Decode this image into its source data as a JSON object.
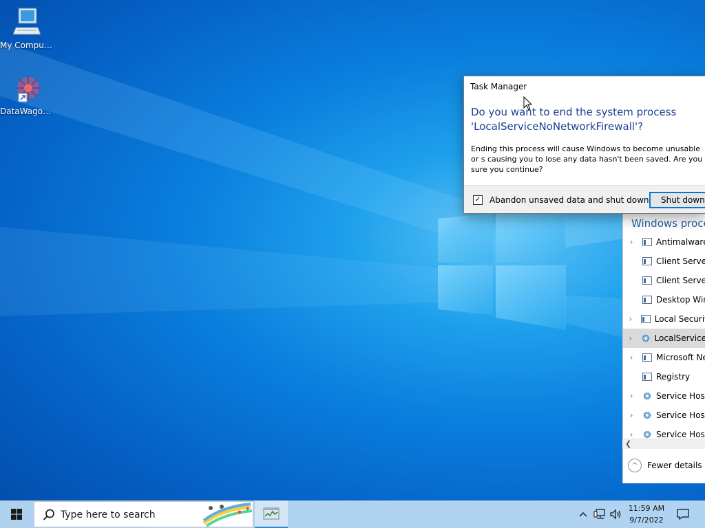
{
  "desktop": {
    "icons": [
      {
        "label": "My Computer",
        "icon": "computer-icon"
      },
      {
        "label": "DataWagon...",
        "icon": "datawagon-shortcut-icon"
      }
    ]
  },
  "dialog": {
    "title": "Task Manager",
    "heading": "Do you want to end the system process 'LocalServiceNoNetworkFirewall'?",
    "body": "Ending this process will cause Windows to become unusable or s causing you to lose any data hasn't been saved. Are you sure you continue?",
    "checkbox_label": "Abandon unsaved data and shut down.",
    "checkbox_checked": true,
    "button_label": "Shut down"
  },
  "task_manager": {
    "section_title": "Windows proce",
    "processes": [
      {
        "name": "Antimalware",
        "expandable": true,
        "icon": "window-icon",
        "selected": false
      },
      {
        "name": "Client Server",
        "expandable": false,
        "icon": "window-icon",
        "selected": false
      },
      {
        "name": "Client Server",
        "expandable": false,
        "icon": "window-icon",
        "selected": false
      },
      {
        "name": "Desktop Win",
        "expandable": false,
        "icon": "window-icon",
        "selected": false
      },
      {
        "name": "Local Security",
        "expandable": true,
        "icon": "window-icon",
        "selected": false
      },
      {
        "name": "LocalServiceN",
        "expandable": true,
        "icon": "gear-icon",
        "selected": true
      },
      {
        "name": "Microsoft Ne",
        "expandable": true,
        "icon": "window-icon",
        "selected": false
      },
      {
        "name": "Registry",
        "expandable": false,
        "icon": "window-icon",
        "selected": false
      },
      {
        "name": "Service Host:",
        "expandable": true,
        "icon": "gear-icon",
        "selected": false
      },
      {
        "name": "Service Host:",
        "expandable": true,
        "icon": "gear-icon",
        "selected": false
      },
      {
        "name": "Service Host:",
        "expandable": true,
        "icon": "gear-icon",
        "selected": false
      }
    ],
    "fewer_details_label": "Fewer details"
  },
  "taskbar": {
    "search_placeholder": "Type here to search",
    "time": "11:59 AM",
    "date": "9/7/2022"
  },
  "colors": {
    "accent": "#0078d7",
    "heading_blue": "#1c3f94",
    "section_blue": "#1e5fa6"
  }
}
